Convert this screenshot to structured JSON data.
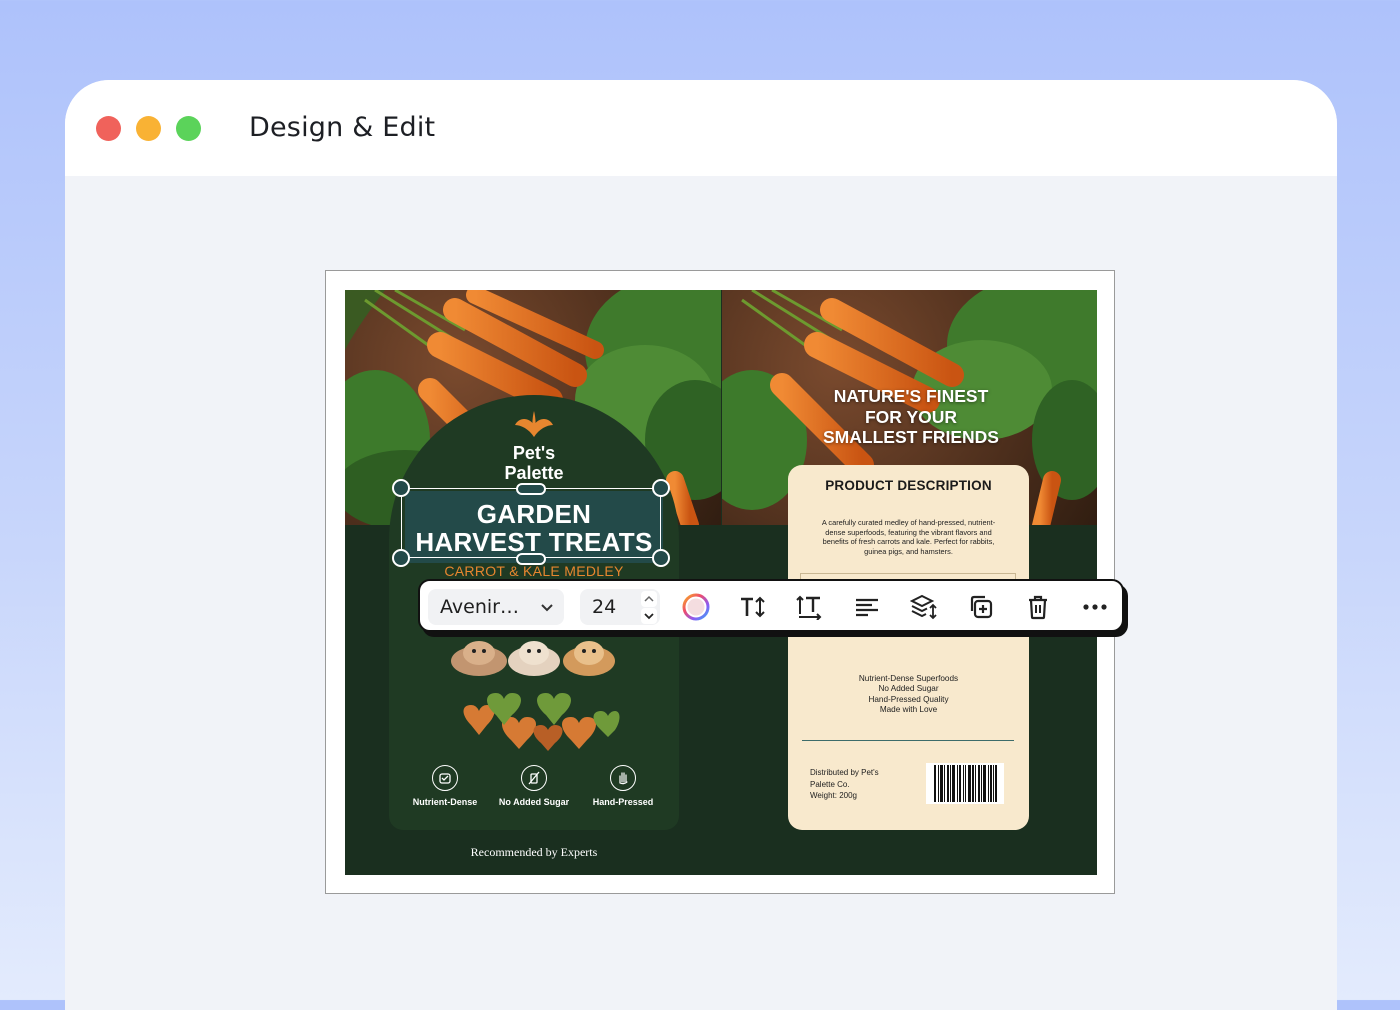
{
  "window": {
    "title": "Design & Edit",
    "controls": [
      "close",
      "minimize",
      "maximize"
    ]
  },
  "label": {
    "front": {
      "brand": "Pet's Palette",
      "brand_icon": "leaf-icon",
      "title": "GARDEN HARVEST TREATS",
      "subtitle": "CARROT & KALE MEDLEY",
      "features": [
        {
          "icon": "nutrient-badge-icon",
          "label": "Nutrient-Dense"
        },
        {
          "icon": "no-sugar-icon",
          "label": "No Added Sugar"
        },
        {
          "icon": "hand-icon",
          "label": "Hand-Pressed"
        }
      ],
      "footer": "Recommended by Experts"
    },
    "back": {
      "tagline": "NATURE'S FINEST FOR YOUR SMALLEST FRIENDS",
      "description_title": "PRODUCT DESCRIPTION",
      "description": "A carefully curated medley of hand-pressed, nutrient-dense superfoods, featuring the vibrant flavors and benefits of fresh carrots and kale. Perfect for rabbits, guinea pigs, and hamsters.",
      "benefits": [
        "Nutrient-Dense Superfoods",
        "No Added Sugar",
        "Hand-Pressed Quality",
        "Made with Love"
      ],
      "distributor": "Distributed by Pet's Palette Co.",
      "weight": "Weight: 200g"
    }
  },
  "toolbar": {
    "font": "Avenir…",
    "font_size": "24",
    "tools": [
      "color-picker-icon",
      "text-size-icon",
      "line-height-icon",
      "align-left-icon",
      "layers-icon",
      "duplicate-icon",
      "delete-icon",
      "more-icon"
    ]
  },
  "colors": {
    "panel_green": "#1f3a23",
    "selection_teal": "#234a49",
    "accent_orange": "#e7862f",
    "cream": "#f8e9cd"
  }
}
